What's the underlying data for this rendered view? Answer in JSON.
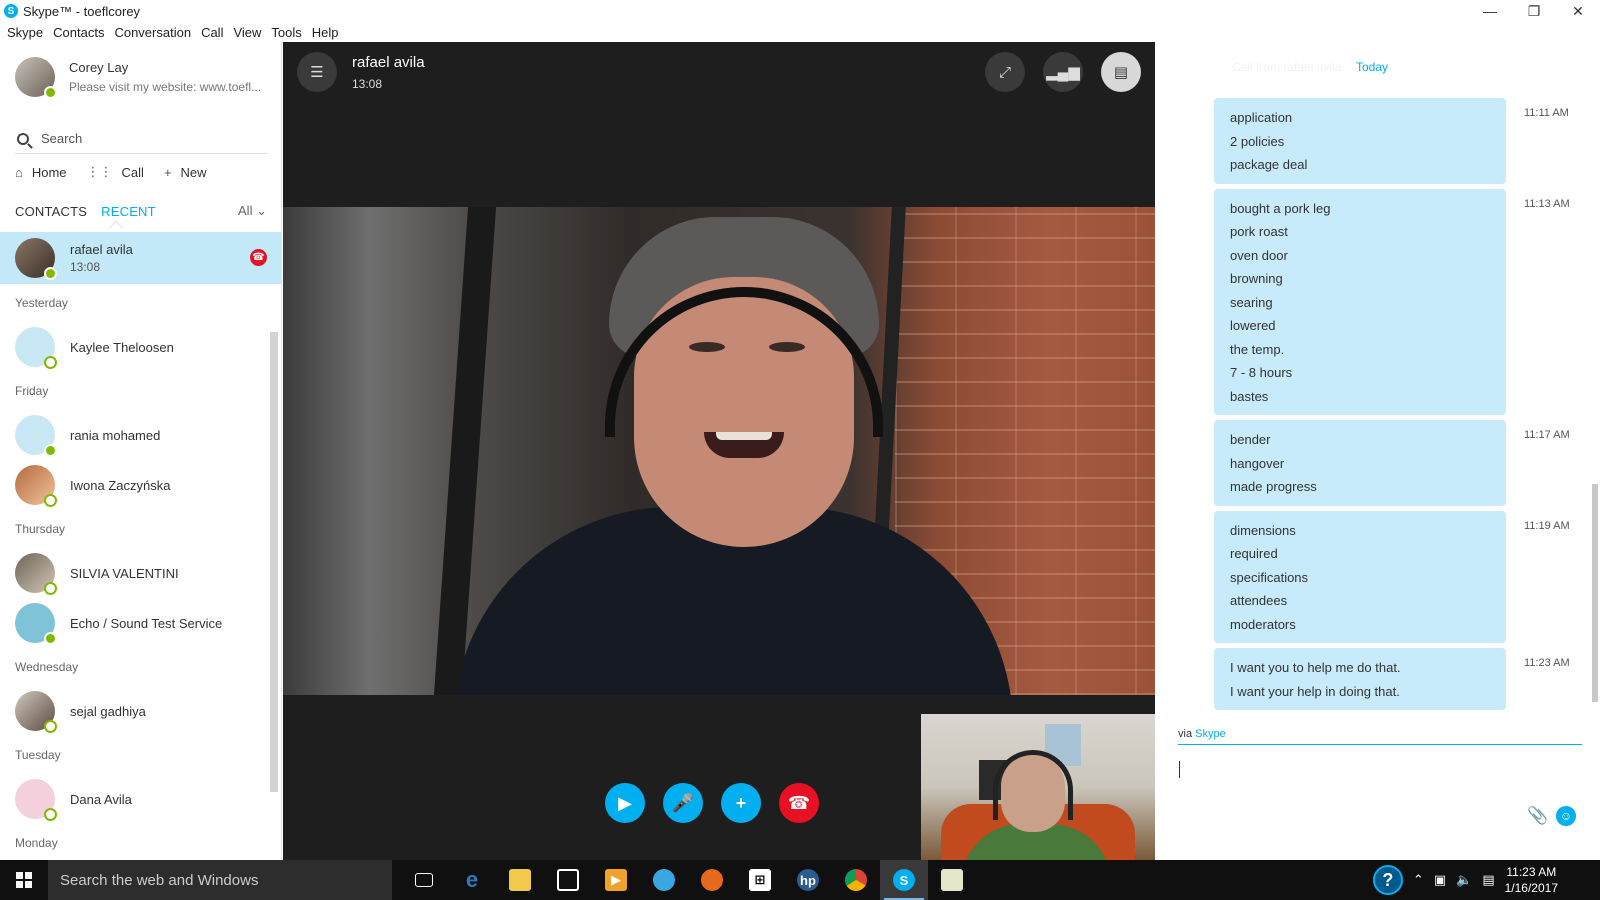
{
  "window": {
    "title": "Skype™ - toeflcorey",
    "logo_letter": "S",
    "minimize": "—",
    "maximize": "❐",
    "close": "✕"
  },
  "menu": [
    "Skype",
    "Contacts",
    "Conversation",
    "Call",
    "View",
    "Tools",
    "Help"
  ],
  "profile": {
    "name": "Corey Lay",
    "mood": "Please visit my website:  www.toefl..."
  },
  "search": {
    "placeholder": "Search"
  },
  "nav": {
    "home": "Home",
    "call": "Call",
    "new": "New"
  },
  "tabs": {
    "contacts": "CONTACTS",
    "recent": "RECENT",
    "filter": "All"
  },
  "contacts": {
    "active": {
      "name": "rafael avila",
      "sub": "13:08"
    },
    "groups": [
      {
        "label": "Yesterday",
        "items": [
          "Kaylee Theloosen"
        ]
      },
      {
        "label": "Friday",
        "items": [
          "rania mohamed",
          "Iwona Zaczyńska"
        ]
      },
      {
        "label": "Thursday",
        "items": [
          "SILVIA VALENTINI",
          "Echo / Sound Test Service"
        ]
      },
      {
        "label": "Wednesday",
        "items": [
          "sejal gadhiya"
        ]
      },
      {
        "label": "Tuesday",
        "items": [
          "Dana Avila"
        ]
      },
      {
        "label": "Monday",
        "items": []
      }
    ]
  },
  "call": {
    "name": "rafael avila",
    "duration": "13:08"
  },
  "chat": {
    "faded_header": "Call from rafael avila",
    "day": "Today",
    "messages": [
      {
        "time": "11:11 AM",
        "lines": [
          "application",
          "2 policies",
          "package deal"
        ]
      },
      {
        "time": "11:13 AM",
        "lines": [
          "bought a pork leg",
          "pork roast",
          "oven door",
          "browning",
          "searing",
          "lowered",
          "the temp.",
          "7 - 8 hours",
          "bastes"
        ]
      },
      {
        "time": "11:17 AM",
        "lines": [
          "bender",
          "hangover",
          "made progress"
        ]
      },
      {
        "time": "11:19 AM",
        "lines": [
          "dimensions",
          "required",
          "specifications",
          "attendees",
          "moderators"
        ]
      },
      {
        "time": "11:23 AM",
        "lines": [
          "I want you to help me do that.",
          "I want your help in doing that."
        ]
      }
    ],
    "via_prefix": "via",
    "via_service": "Skype"
  },
  "taskbar": {
    "search_placeholder": "Search the web and Windows",
    "time": "11:23 AM",
    "date": "1/16/2017"
  },
  "colors": {
    "accent": "#00aff0",
    "hangup": "#e81123",
    "online": "#7fba00",
    "bubble": "#c7ebfa",
    "selected_row": "#c3e8f7"
  }
}
